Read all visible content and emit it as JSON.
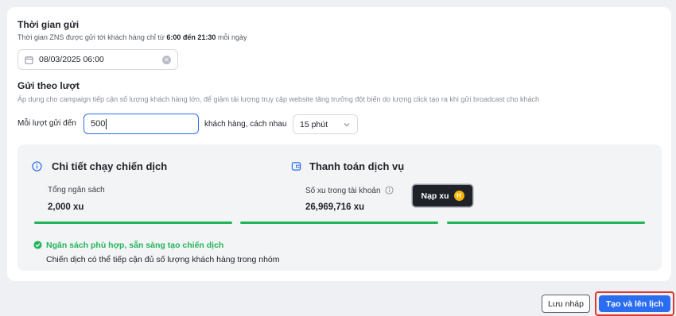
{
  "send_time": {
    "title": "Thời gian gửi",
    "desc_prefix": "Thời gian ZNS được gửi tới khách hàng chỉ từ",
    "desc_range": "6:00 đến 21:30",
    "desc_suffix": "mỗi ngày",
    "date_value": "08/03/2025 06:00"
  },
  "batch": {
    "title": "Gửi theo lượt",
    "hint": "Áp dụng cho campaign tiếp cận số lượng khách hàng lớn, để giảm tải lượng truy cập website tăng trưởng đột biến do lượng click tạo ra khi gửi broadcast cho khách",
    "per_batch_label": "Mỗi lượt gửi đến",
    "per_batch_value": "500",
    "unit_label": "khách hàng, cách nhau",
    "interval_value": "15 phút"
  },
  "summary": {
    "details_title": "Chi tiết chạy chiến dịch",
    "budget_label": "Tổng ngân sách",
    "budget_value": "2,000 xu",
    "payment_title": "Thanh toán dịch vụ",
    "balance_label": "Số xu trong tài khoản",
    "balance_value": "26,969,716 xu",
    "topup_label": "Nạp xu",
    "coin_symbol": "H",
    "ok_message": "Ngân sách phù hợp, sẵn sàng tạo chiến dịch",
    "ok_desc": "Chiến dịch có thể tiếp cận đủ số lượng khách hàng trong nhóm",
    "progress_segments": 3
  },
  "footer": {
    "draft_label": "Lưu nháp",
    "create_label": "Tạo và lên lịch"
  },
  "colors": {
    "accent": "#2a6df0",
    "success": "#22b45a",
    "highlight": "#e0362c"
  }
}
